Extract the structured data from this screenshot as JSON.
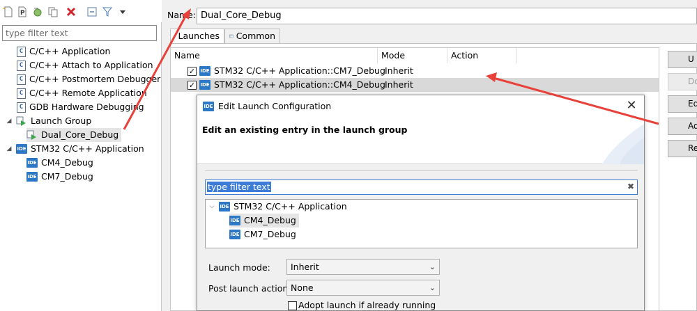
{
  "left_panel": {
    "filter_placeholder": "type filter text",
    "tree": [
      {
        "label": "C/C++ Application"
      },
      {
        "label": "C/C++ Attach to Application"
      },
      {
        "label": "C/C++ Postmortem Debugger"
      },
      {
        "label": "C/C++ Remote Application"
      },
      {
        "label": "GDB Hardware Debugging"
      },
      {
        "label": "Launch Group"
      },
      {
        "label": "Dual_Core_Debug"
      },
      {
        "label": "STM32 C/C++ Application"
      },
      {
        "label": "CM4_Debug"
      },
      {
        "label": "CM7_Debug"
      }
    ]
  },
  "config": {
    "name_label": "Name:",
    "name_value": "Dual_Core_Debug",
    "tabs": [
      {
        "label": "Launches"
      },
      {
        "label": "Common"
      }
    ],
    "table": {
      "columns": [
        "Name",
        "Mode",
        "Action"
      ],
      "rows": [
        {
          "name": "STM32 C/C++ Application::CM7_Debug",
          "mode": "Inherit",
          "action": ""
        },
        {
          "name": "STM32 C/C++ Application::CM4_Debug",
          "mode": "Inherit",
          "action": ""
        }
      ]
    },
    "buttons": [
      "U",
      "Do",
      "Ed",
      "Ad",
      "Rer"
    ]
  },
  "dialog": {
    "title": "Edit Launch Configuration",
    "heading": "Edit an existing entry in the launch group",
    "filter_text": "type filter text",
    "tree": {
      "root": "STM32 C/C++ Application",
      "children": [
        "CM4_Debug",
        "CM7_Debug"
      ]
    },
    "launch_mode_label": "Launch mode:",
    "launch_mode_value": "Inherit",
    "post_action_label": "Post launch action:",
    "post_action_value": "None",
    "adopt_label": "Adopt launch if already running"
  },
  "icons": {
    "ide_badge": "IDE",
    "c_badge": "C",
    "accent": "#2b78c6",
    "arrow_color": "#e8413a"
  }
}
